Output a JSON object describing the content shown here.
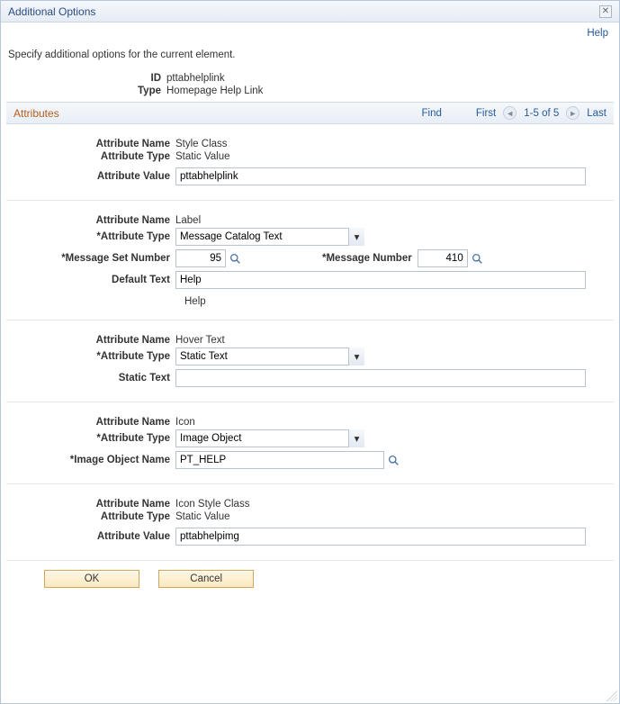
{
  "window": {
    "title": "Additional Options",
    "help_link": "Help"
  },
  "instruction": "Specify additional options for the current element.",
  "meta": {
    "id_label": "ID",
    "id_value": "pttabhelplink",
    "type_label": "Type",
    "type_value": "Homepage Help Link"
  },
  "section": {
    "title": "Attributes",
    "find": "Find",
    "first": "First",
    "range": "1-5 of 5",
    "last": "Last"
  },
  "labels": {
    "attribute_name": "Attribute Name",
    "attribute_type": "Attribute Type",
    "attribute_type_req": "*Attribute Type",
    "attribute_value": "Attribute Value",
    "message_set_number": "*Message Set Number",
    "message_number": "*Message Number",
    "default_text": "Default Text",
    "static_text": "Static Text",
    "image_object_name": "*Image Object Name"
  },
  "blocks": [
    {
      "name": "Style Class",
      "type": "Static Value",
      "value": "pttabhelplink"
    },
    {
      "name": "Label",
      "type_select": "Message Catalog Text",
      "msg_set": "95",
      "msg_num": "410",
      "default_text": "Help",
      "note": "Help"
    },
    {
      "name": "Hover Text",
      "type_select": "Static Text",
      "static_text": ""
    },
    {
      "name": "Icon",
      "type_select": "Image Object",
      "image_object": "PT_HELP"
    },
    {
      "name": "Icon Style Class",
      "type": "Static Value",
      "value": "pttabhelpimg"
    }
  ],
  "buttons": {
    "ok": "OK",
    "cancel": "Cancel"
  }
}
